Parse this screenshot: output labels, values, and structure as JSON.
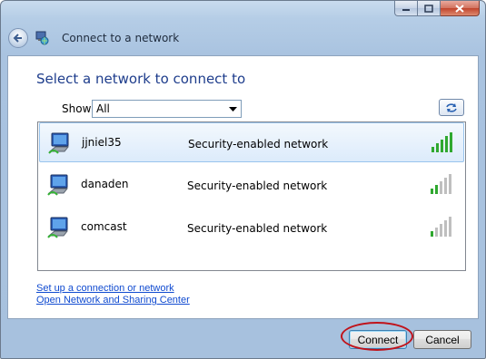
{
  "window": {
    "title": "Connect to a network"
  },
  "main": {
    "heading": "Select a network to connect to",
    "show_label": "Show",
    "show_selected": "All"
  },
  "networks": [
    {
      "name": "jjniel35",
      "security": "Security-enabled network",
      "signal_bars": 5,
      "selected": true
    },
    {
      "name": "danaden",
      "security": "Security-enabled network",
      "signal_bars": 2,
      "selected": false
    },
    {
      "name": "comcast",
      "security": "Security-enabled network",
      "signal_bars": 1,
      "selected": false
    }
  ],
  "links": {
    "setup": "Set up a connection or network",
    "sharing": "Open Network and Sharing Center"
  },
  "buttons": {
    "connect": "Connect",
    "cancel": "Cancel"
  },
  "colors": {
    "heading": "#1e3d8c",
    "link": "#0f4ad0",
    "signal_on": "#2fa82f",
    "signal_off": "#bfbfbf",
    "highlight_ring": "#c0131b"
  },
  "icons": {
    "back": "back-arrow-icon",
    "app": "network-globe-icon",
    "network": "wireless-computer-icon",
    "refresh": "refresh-arrows-icon"
  }
}
